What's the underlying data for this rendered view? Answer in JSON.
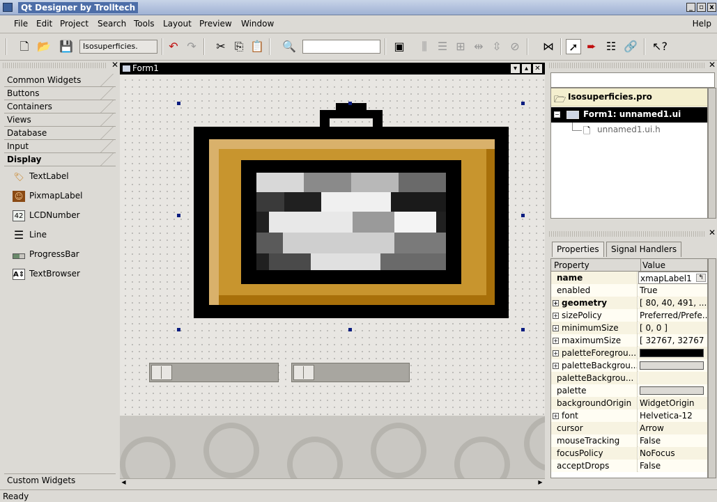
{
  "window": {
    "title": "Qt Designer by Trolltech",
    "buttons": [
      "_",
      "▫",
      "x"
    ]
  },
  "menu": {
    "items": [
      "File",
      "Edit",
      "Project",
      "Search",
      "Tools",
      "Layout",
      "Preview",
      "Window"
    ],
    "help": "Help"
  },
  "toolbar": {
    "project_combo": "Isosuperficies."
  },
  "toolbox": {
    "categories": [
      "Common Widgets",
      "Buttons",
      "Containers",
      "Views",
      "Database",
      "Input",
      "Display"
    ],
    "active_category": "Display",
    "widgets": [
      {
        "label": "TextLabel",
        "icon": "label-tag-icon"
      },
      {
        "label": "PixmapLabel",
        "icon": "pixmap-portrait-icon"
      },
      {
        "label": "LCDNumber",
        "icon": "lcd-number-icon"
      },
      {
        "label": "Line",
        "icon": "line-icon"
      },
      {
        "label": "ProgressBar",
        "icon": "progressbar-icon"
      },
      {
        "label": "TextBrowser",
        "icon": "textbrowser-icon"
      }
    ],
    "footer": "Custom Widgets"
  },
  "form": {
    "title": "Form1"
  },
  "project": {
    "name": "Isosuperficies.pro",
    "form_item": "Form1: unnamed1.ui",
    "source_item": "unnamed1.ui.h"
  },
  "properties": {
    "tabs": [
      "Properties",
      "Signal Handlers"
    ],
    "headers": {
      "property": "Property",
      "value": "Value"
    },
    "rows": [
      {
        "name": "name",
        "value": "xmapLabel1",
        "bold": true,
        "expand": false
      },
      {
        "name": "enabled",
        "value": "True",
        "bold": false,
        "expand": false
      },
      {
        "name": "geometry",
        "value": "[ 80, 40, 491, ...",
        "bold": true,
        "expand": true
      },
      {
        "name": "sizePolicy",
        "value": "Preferred/Prefe...",
        "bold": false,
        "expand": true
      },
      {
        "name": "minimumSize",
        "value": "[ 0, 0 ]",
        "bold": false,
        "expand": true
      },
      {
        "name": "maximumSize",
        "value": "[ 32767, 32767 ]",
        "bold": false,
        "expand": true
      },
      {
        "name": "paletteForegrou...",
        "value": "",
        "bold": false,
        "expand": true,
        "swatch": "#000000"
      },
      {
        "name": "paletteBackgrou...",
        "value": "",
        "bold": false,
        "expand": true,
        "swatch": "#dcdad5"
      },
      {
        "name": "paletteBackgrou...",
        "value": "",
        "bold": false,
        "expand": false
      },
      {
        "name": "palette",
        "value": "",
        "bold": false,
        "expand": false,
        "swatch": "#dcdad5"
      },
      {
        "name": "backgroundOrigin",
        "value": "WidgetOrigin",
        "bold": false,
        "expand": false
      },
      {
        "name": "font",
        "value": "Helvetica-12",
        "bold": false,
        "expand": true
      },
      {
        "name": "cursor",
        "value": "Arrow",
        "bold": false,
        "expand": false
      },
      {
        "name": "mouseTracking",
        "value": "False",
        "bold": false,
        "expand": false
      },
      {
        "name": "focusPolicy",
        "value": "NoFocus",
        "bold": false,
        "expand": false
      },
      {
        "name": "acceptDrops",
        "value": "False",
        "bold": false,
        "expand": false
      }
    ]
  },
  "status": {
    "text": "Ready"
  },
  "colors": {
    "frame_gold": "#a8700a",
    "selection_handle": "#0b1d80",
    "title_blue": "#4d6ea8"
  }
}
